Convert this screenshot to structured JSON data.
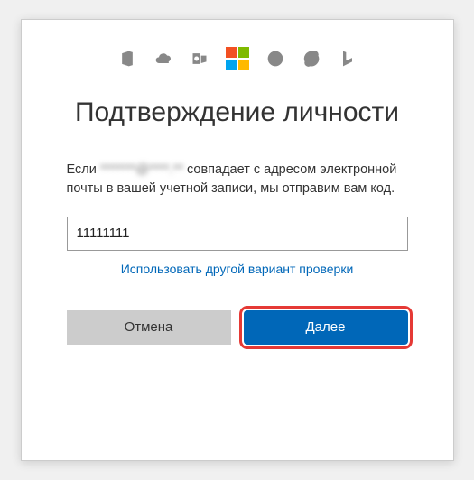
{
  "icons": {
    "office": "office-icon",
    "onedrive": "onedrive-icon",
    "outlook": "outlook-icon",
    "microsoft": "microsoft-logo",
    "xbox": "xbox-icon",
    "skype": "skype-icon",
    "bing": "bing-icon"
  },
  "title": "Подтверждение личности",
  "desc": {
    "prefix": "Если ",
    "masked_email": "*******@****.**",
    "rest": " совпадает с адресом электронной почты в вашей учетной записи, мы отправим вам код."
  },
  "code_input": {
    "value": "11111111",
    "placeholder": ""
  },
  "alt_link": "Использовать другой вариант проверки",
  "buttons": {
    "cancel": "Отмена",
    "next": "Далее"
  },
  "colors": {
    "primary": "#0067b8",
    "highlight_outline": "#e53935"
  }
}
